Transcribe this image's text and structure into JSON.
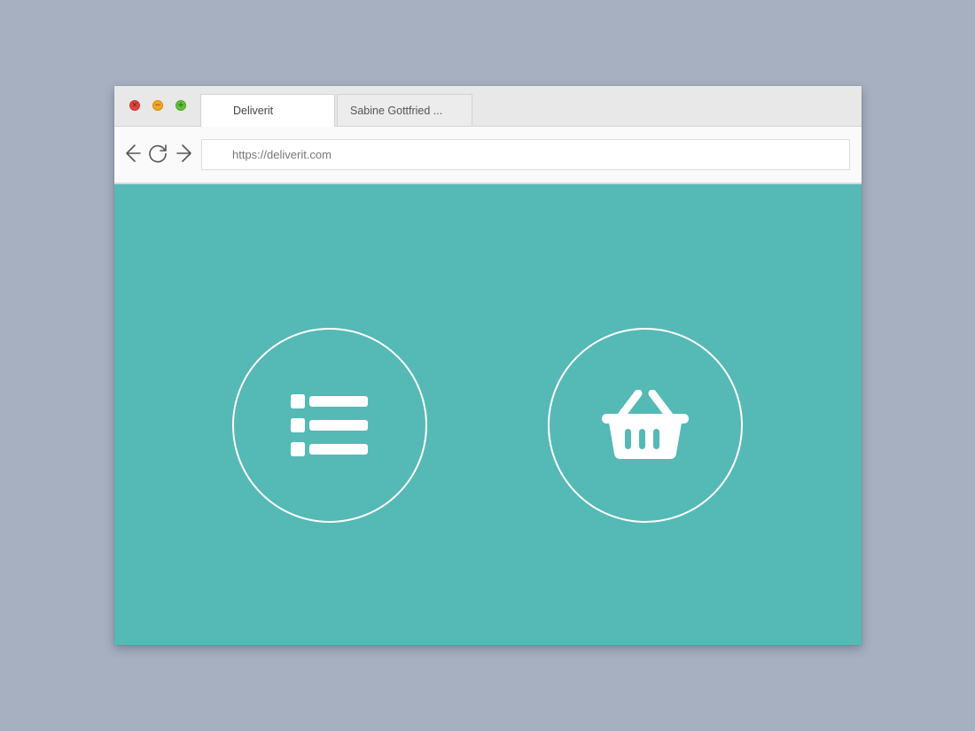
{
  "window": {
    "controls": {
      "close_icon": "close-icon",
      "minimize_icon": "minimize-icon",
      "maximize_icon": "maximize-icon"
    },
    "tabs": [
      {
        "label": "Deliverit",
        "active": true
      },
      {
        "label": "Sabine Gottfried ...",
        "active": false
      }
    ]
  },
  "toolbar": {
    "back_icon": "arrow-left-icon",
    "reload_icon": "reload-icon",
    "forward_icon": "arrow-right-icon",
    "url": "https://deliverit.com"
  },
  "content": {
    "background_color": "#55b9b6",
    "buttons": [
      {
        "icon": "list-icon"
      },
      {
        "icon": "basket-icon"
      }
    ]
  }
}
